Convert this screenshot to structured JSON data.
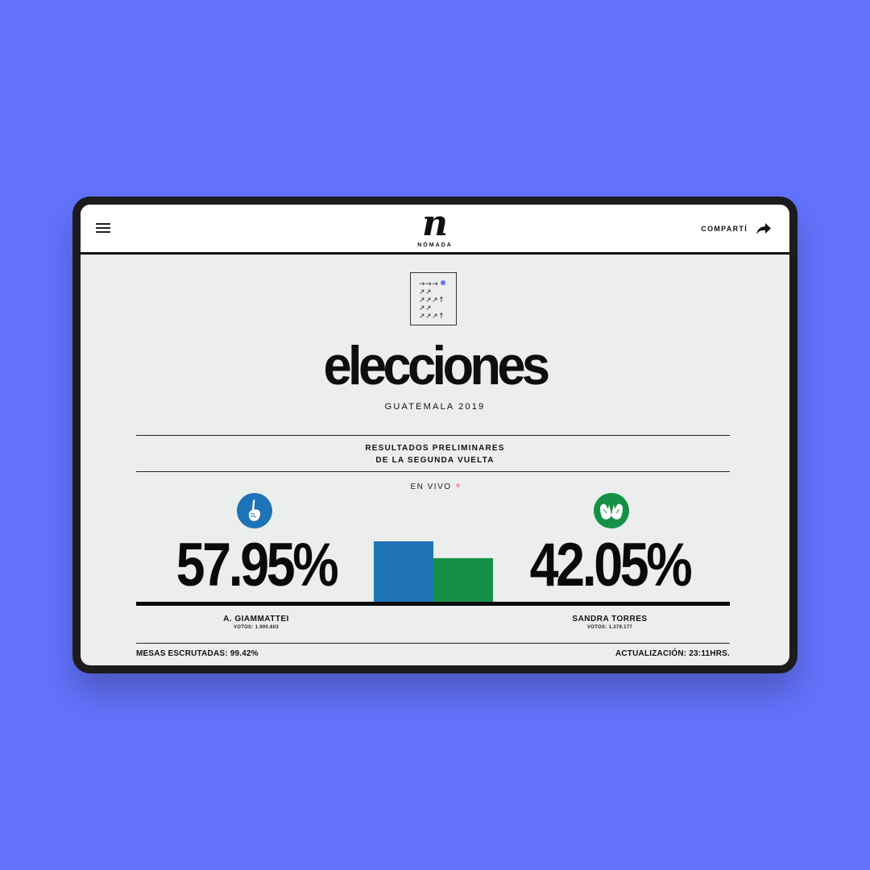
{
  "header": {
    "logo_mark": "n",
    "logo_text": "NÓMADA",
    "share_label": "COMPARTÍ"
  },
  "hero": {
    "title": "elecciones",
    "subtitle": "GUATEMALA 2019"
  },
  "results": {
    "heading_line1": "RESULTADOS PRELIMINARES",
    "heading_line2": "DE LA SEGUNDA VUELTA",
    "live_label": "EN VIVO",
    "candidates": [
      {
        "name": "A. GIAMMATTEI",
        "percent_label": "57.95%",
        "percent": 57.95,
        "votes_label": "VOTOS: 1.900.603",
        "color": "#1f73b7",
        "icon": "raised-finger-icon"
      },
      {
        "name": "SANDRA TORRES",
        "percent_label": "42.05%",
        "percent": 42.05,
        "votes_label": "VOTOS: 1.379.177",
        "color": "#149146",
        "icon": "open-hands-icon"
      }
    ]
  },
  "footer": {
    "tables_counted": "MESAS ESCRUTADAS: 99.42%",
    "update_time": "ACTUALIZACIÓN: 23:11HRS."
  },
  "colors": {
    "background": "#6373fd",
    "screen": "#ebeeed",
    "accent_dot": "#6373fd",
    "live_dot": "#f2a1a8"
  }
}
